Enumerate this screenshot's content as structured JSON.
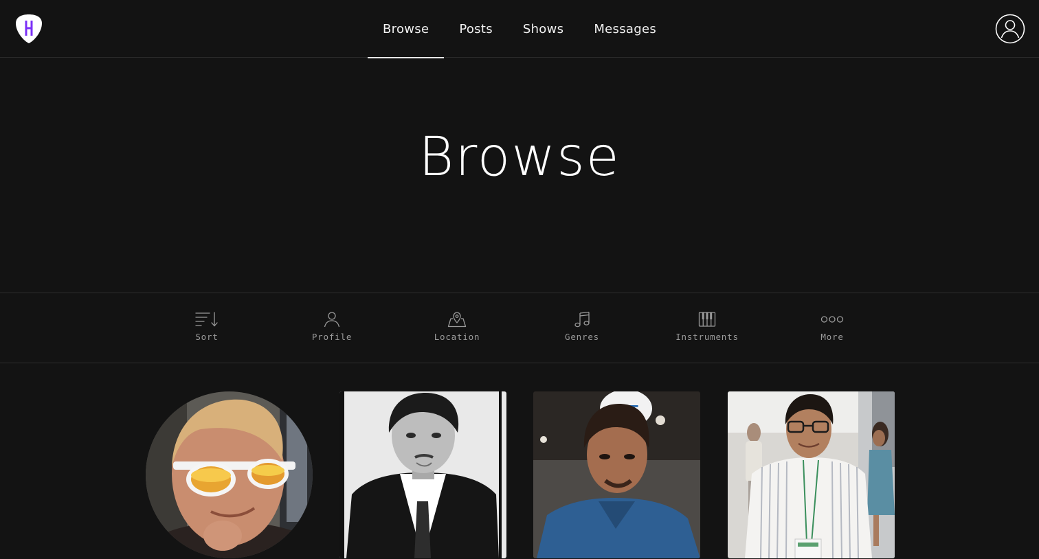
{
  "app": {
    "logo_icon": "guitar-pick-logo-icon",
    "accent_color": "#7b2ff7"
  },
  "nav": {
    "items": [
      {
        "label": "Browse",
        "active": true
      },
      {
        "label": "Posts",
        "active": false
      },
      {
        "label": "Shows",
        "active": false
      },
      {
        "label": "Messages",
        "active": false
      }
    ],
    "account_icon": "user-circle-icon"
  },
  "hero": {
    "title": "Browse"
  },
  "filters": [
    {
      "label": "Sort",
      "icon": "sort-icon"
    },
    {
      "label": "Profile",
      "icon": "person-icon"
    },
    {
      "label": "Location",
      "icon": "map-pin-icon"
    },
    {
      "label": "Genres",
      "icon": "music-note-icon"
    },
    {
      "label": "Instruments",
      "icon": "piano-keys-icon"
    },
    {
      "label": "More",
      "icon": "more-dots-icon"
    }
  ],
  "profiles": [
    {
      "shape": "circle",
      "photo": "man-with-sunglasses"
    },
    {
      "shape": "square",
      "photo": "man-in-suit-bw"
    },
    {
      "shape": "square",
      "photo": "man-in-blue-shirt"
    },
    {
      "shape": "square",
      "photo": "man-with-glasses-striped-shirt"
    }
  ]
}
